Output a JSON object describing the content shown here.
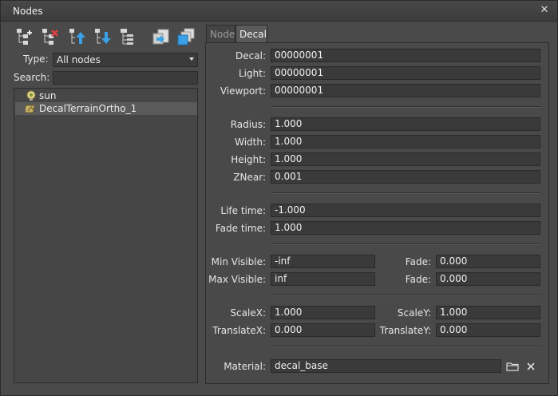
{
  "window": {
    "title": "Nodes",
    "close_glyph": "✕"
  },
  "toolbar": {
    "icons": [
      "node-add-icon",
      "node-remove-icon",
      "move-up-icon",
      "move-down-icon",
      "tree-view-icon",
      "import-icon",
      "clone-icon"
    ]
  },
  "filter": {
    "type_label": "Type:",
    "type_value": "All nodes",
    "search_label": "Search:",
    "search_value": ""
  },
  "tree": {
    "items": [
      {
        "label": "sun",
        "icon": "light-bulb-icon",
        "selected": false
      },
      {
        "label": "DecalTerrainOrtho_1",
        "icon": "decal-icon",
        "selected": true
      }
    ]
  },
  "tabs": [
    {
      "label": "Node",
      "active": false
    },
    {
      "label": "Decal",
      "active": true
    }
  ],
  "decal": {
    "decal_label": "Decal:",
    "decal_value": "00000001",
    "light_label": "Light:",
    "light_value": "00000001",
    "viewport_label": "Viewport:",
    "viewport_value": "00000001",
    "radius_label": "Radius:",
    "radius_value": "1.000",
    "width_label": "Width:",
    "width_value": "1.000",
    "height_label": "Height:",
    "height_value": "1.000",
    "znear_label": "ZNear:",
    "znear_value": "0.001",
    "lifetime_label": "Life time:",
    "lifetime_value": "-1.000",
    "fadetime_label": "Fade time:",
    "fadetime_value": "1.000",
    "minvisible_label": "Min Visible:",
    "minvisible_value": "-inf",
    "minfade_label": "Fade:",
    "minfade_value": "0.000",
    "maxvisible_label": "Max Visible:",
    "maxvisible_value": "inf",
    "maxfade_label": "Fade:",
    "maxfade_value": "0.000",
    "scalex_label": "ScaleX:",
    "scalex_value": "1.000",
    "scaley_label": "ScaleY:",
    "scaley_value": "1.000",
    "translatex_label": "TranslateX:",
    "translatex_value": "0.000",
    "translatey_label": "TranslateY:",
    "translatey_value": "0.000",
    "material_label": "Material:",
    "material_value": "decal_base"
  }
}
